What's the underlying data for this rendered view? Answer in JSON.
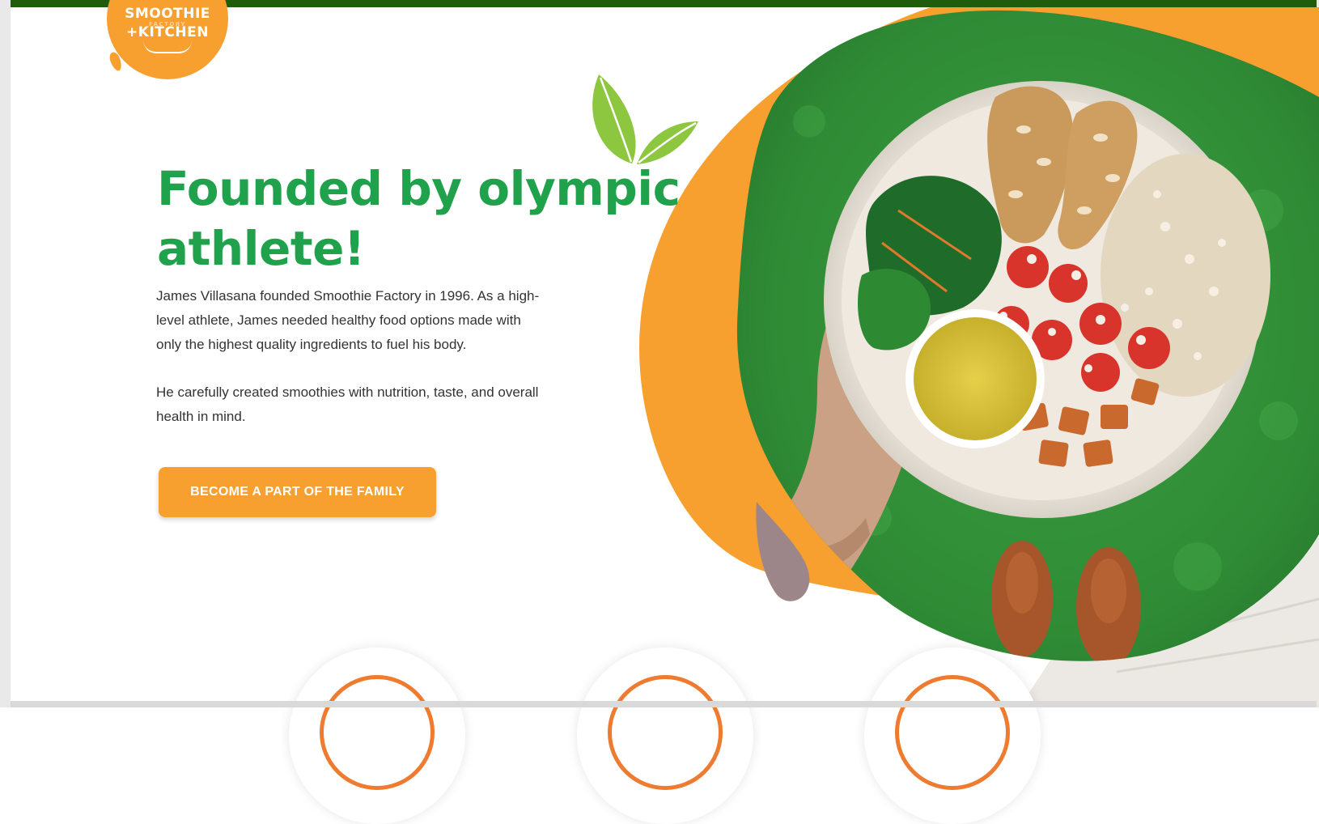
{
  "brand": {
    "logo_line1": "SMOOTHIE",
    "logo_small": "FACTORY",
    "logo_line2": "+KITCHEN",
    "colors": {
      "orange": "#f79f2f",
      "green_headline": "#1fa24b",
      "dark_green_bar": "#1f5d0c",
      "leaf_green": "#8dc63f",
      "feature_ring": "#ee7b2f"
    }
  },
  "hero": {
    "headline": "Founded by olympic athlete!",
    "paragraph_1": "James Villasana founded Smoothie Factory in 1996. As a high-level athlete, James needed healthy food options made with only the highest quality ingredients to fuel his body.",
    "paragraph_2": "He carefully created smoothies with nutrition, taste, and overall health in mind.",
    "cta_label": "BECOME A PART OF THE FAMILY"
  },
  "features": [
    {
      "icon": "feature-icon"
    },
    {
      "icon": "feature-icon"
    },
    {
      "icon": "feature-icon"
    }
  ]
}
